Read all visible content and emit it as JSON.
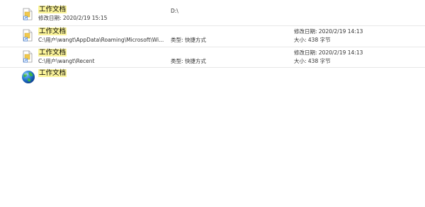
{
  "results": [
    {
      "icon": "shortcut-document-icon",
      "name": "工作文档",
      "subline": "修改日期: 2020/2/19 15:15",
      "location": "D:\\",
      "modified": "",
      "size": "",
      "type": ""
    },
    {
      "icon": "shortcut-document-icon",
      "name": "工作文档",
      "subline": "C:\\用户\\wangt\\AppData\\Roaming\\Microsoft\\Wi...",
      "location": "",
      "type": "类型: 快捷方式",
      "modified": "修改日期: 2020/2/19 14:13",
      "size": "大小: 438 字节"
    },
    {
      "icon": "shortcut-document-icon",
      "name": "工作文档",
      "subline": "C:\\用户\\wangt\\Recent",
      "location": "",
      "type": "类型: 快捷方式",
      "modified": "修改日期: 2020/2/19 14:13",
      "size": "大小: 438 字节"
    },
    {
      "icon": "globe-icon",
      "name": "工作文档",
      "subline": "",
      "location": "",
      "type": "",
      "modified": "",
      "size": ""
    }
  ]
}
